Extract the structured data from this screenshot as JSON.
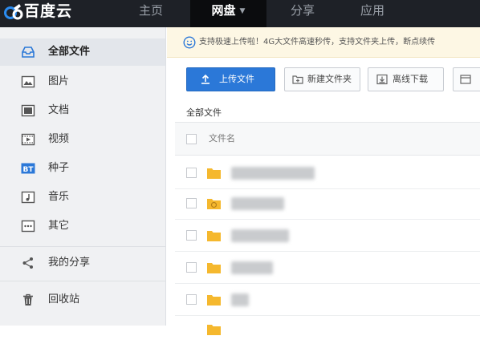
{
  "brand": {
    "name": "百度云"
  },
  "nav": {
    "items": [
      {
        "label": "主页"
      },
      {
        "label": "网盘",
        "active": true
      },
      {
        "label": "分享"
      },
      {
        "label": "应用"
      }
    ]
  },
  "sidebar": {
    "items": [
      {
        "label": "全部文件",
        "icon": "folder-outline-icon",
        "active": true
      },
      {
        "label": "图片",
        "icon": "image-icon"
      },
      {
        "label": "文档",
        "icon": "document-icon"
      },
      {
        "label": "视频",
        "icon": "video-icon"
      },
      {
        "label": "种子",
        "icon": "bt-torrent-icon",
        "badge": "BT"
      },
      {
        "label": "音乐",
        "icon": "music-icon"
      },
      {
        "label": "其它",
        "icon": "more-icon"
      },
      {
        "label": "我的分享",
        "icon": "share-icon"
      },
      {
        "label": "回收站",
        "icon": "trash-icon"
      }
    ]
  },
  "notice": {
    "text": "支持极速上传啦！4G大文件高速秒传，支持文件夹上传，断点续传"
  },
  "toolbar": {
    "upload_label": "上传文件",
    "new_folder_label": "新建文件夹",
    "offline_download_label": "离线下载"
  },
  "breadcrumb": {
    "label": "全部文件"
  },
  "table": {
    "name_header": "文件名"
  },
  "colors": {
    "accent": "#2b78d8",
    "nav_bg": "#1e2127",
    "sidebar_bg": "#f0f1f3",
    "notice_bg": "#fdf7e4",
    "folder": "#f5b82e"
  }
}
